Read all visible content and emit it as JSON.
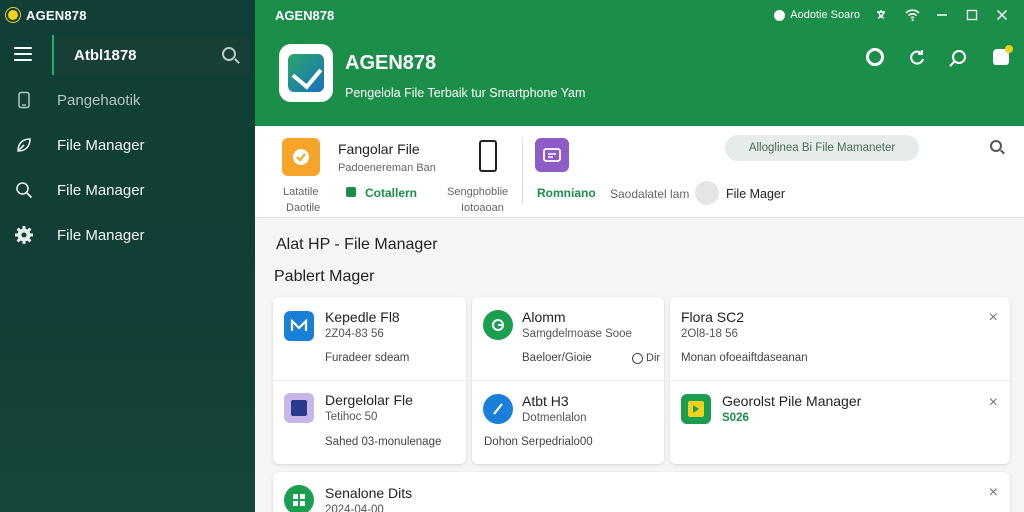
{
  "window": {
    "app_title": "AGEN878",
    "center_title": "AGEN878",
    "status_text": "Aodotie Soaro",
    "icons": [
      "app-logo-icon",
      "status-dot-icon",
      "translate-icon",
      "wifi-icon",
      "minimize-icon",
      "maximize-icon",
      "close-icon"
    ]
  },
  "sidebar": {
    "search_value": "Atbl1878",
    "items": [
      {
        "label": "Pangehaotik",
        "icon": "phone-icon"
      },
      {
        "label": "File Manager",
        "icon": "leaf-icon"
      },
      {
        "label": "File Manager",
        "icon": "search-icon"
      },
      {
        "label": "File Manager",
        "icon": "gear-icon"
      }
    ]
  },
  "header": {
    "app_name": "AGEN878",
    "tagline": "Pengelola File Terbaik tur Smartphone Yam"
  },
  "toolbar": {
    "tool1_title": "Fangolar File",
    "tool1_sub": "Padoenereman Ban",
    "tool1_left_a": "Latatile",
    "tool1_left_b": "Daotile",
    "tool1_link": "Cotallern",
    "tool2_a": "Sengphoblie",
    "tool2_b": "Iotoaoan",
    "tool3_label": "Romniano",
    "tool4_label": "Saodalatel lam",
    "tool5_label": "File Mager",
    "pill": "Alloglinea Bi File Mamaneter"
  },
  "content": {
    "section1": "Alat HP - File Manager",
    "section2": "Pablert Mager",
    "cards": [
      {
        "name": "Kepedle Fl8",
        "meta": "2Z04-83 56",
        "foot": "Furadeer sdeam",
        "icon": "m-icon",
        "color": "#1a7fd9"
      },
      {
        "name": "Dergelolar Fle",
        "meta": "Tetihoc 50",
        "foot": "Sahed 03-monulenage",
        "icon": "t-icon",
        "color": "#8e5cc7"
      },
      {
        "name": "Alomm",
        "meta": "Samgdelmoase Sooe",
        "foot": "Baeloer/Gioie",
        "icon": "g-icon",
        "color": "#1b9e4f"
      },
      {
        "name": "Atbt H3",
        "meta": "Dotmenlalon",
        "foot": "Dohon Serpedrialo00",
        "icon": "d-icon",
        "color": "#1a7fd9"
      },
      {
        "name": "Flora SC2",
        "meta": "2Ol8-18 56",
        "foot": "Monan ofoeaiftdaseanan",
        "icon": "",
        "color": "#ffffff"
      },
      {
        "name": "Georolst Pile Manager",
        "meta": "S026",
        "foot": "",
        "icon": "play-icon",
        "color": "#1b9e4f"
      },
      {
        "name": "Senalone Dits",
        "meta": "2024-04-00",
        "foot": "",
        "icon": "grid-icon",
        "color": "#1b9e4f"
      }
    ],
    "extra_badge": "Dir"
  }
}
